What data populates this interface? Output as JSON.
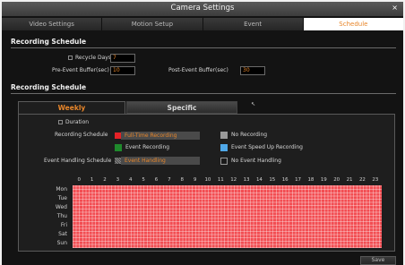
{
  "window": {
    "title": "Camera Settings",
    "close_label": "×"
  },
  "tabs": [
    {
      "label": "Video Settings"
    },
    {
      "label": "Motion Setup"
    },
    {
      "label": "Event"
    },
    {
      "label": "Schedule"
    }
  ],
  "recording": {
    "section_title": "Recording Schedule",
    "recycle_label": "Recycle Days",
    "recycle_value": "7",
    "pre_label": "Pre-Event Buffer(sec)",
    "pre_value": "10",
    "post_label": "Post-Event Buffer(sec)",
    "post_value": "30"
  },
  "schedule": {
    "section_title": "Recording Schedule",
    "subtabs": [
      {
        "label": "Weekly"
      },
      {
        "label": "Specific"
      }
    ],
    "duration_label": "Duration",
    "rec_schedule_label": "Recording Schedule",
    "event_schedule_label": "Event Handling Schedule",
    "legend": {
      "full_time": "Full-Time Recording",
      "no_recording": "No Recording",
      "event_recording": "Event Recording",
      "speed_up": "Event Speed Up Recording",
      "event_handling": "Event Handling",
      "no_event_handling": "No Event Handling"
    },
    "colors": {
      "full_time": "#e52227",
      "no_recording": "#9a9a9a",
      "event_recording": "#1f8a2c",
      "speed_up": "#4fa8e8",
      "event_handling": "#6c6c6c",
      "no_event_handling": "#1a1a1a"
    },
    "hours": [
      "0",
      "1",
      "2",
      "3",
      "4",
      "5",
      "6",
      "7",
      "8",
      "9",
      "10",
      "11",
      "12",
      "13",
      "14",
      "15",
      "16",
      "17",
      "18",
      "19",
      "20",
      "21",
      "22",
      "23"
    ],
    "days": [
      "Mon",
      "Tue",
      "Wed",
      "Thu",
      "Fri",
      "Sat",
      "Sun"
    ],
    "grid_fill": "Full-Time Recording"
  },
  "save_label": "Save"
}
